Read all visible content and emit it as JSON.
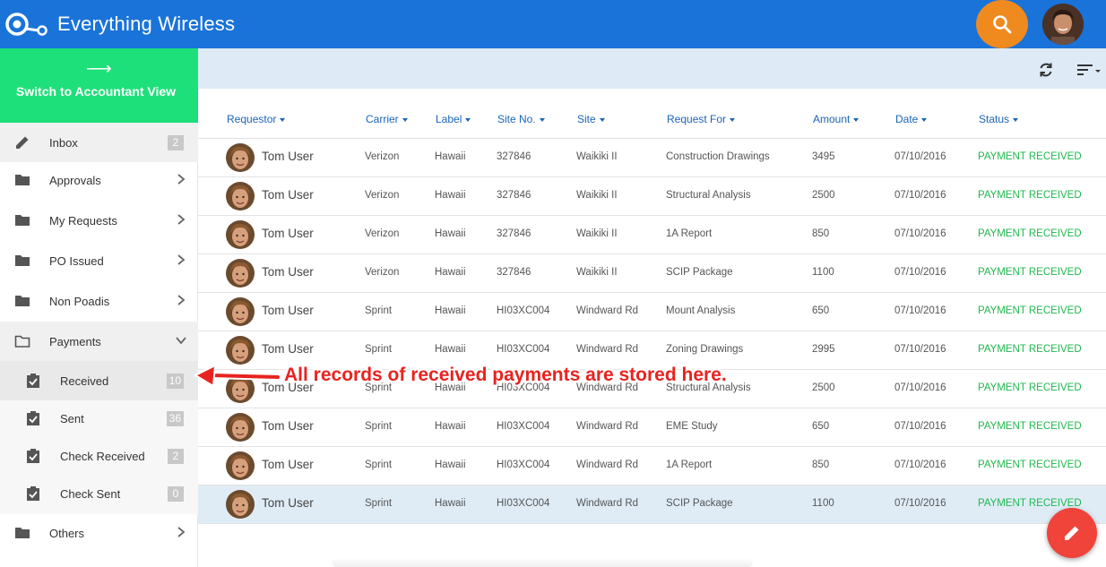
{
  "app": {
    "title": "Everything Wireless"
  },
  "sidebar": {
    "switch_label": "Switch to Accountant View",
    "switch_arrow": "⟶",
    "items": [
      {
        "label": "Inbox",
        "icon": "pencil-icon",
        "badge": "2"
      },
      {
        "label": "Approvals",
        "icon": "folder-icon"
      },
      {
        "label": "My Requests",
        "icon": "folder-icon"
      },
      {
        "label": "PO Issued",
        "icon": "folder-icon"
      },
      {
        "label": "Non Poadis",
        "icon": "folder-icon"
      },
      {
        "label": "Payments",
        "icon": "folder-open-icon",
        "expanded": true
      },
      {
        "label": "Received",
        "icon": "clipboard-check-icon",
        "badge": "10",
        "selected": true
      },
      {
        "label": "Sent",
        "icon": "clipboard-check-icon",
        "badge": "36"
      },
      {
        "label": "Check Received",
        "icon": "clipboard-check-icon",
        "badge": "2"
      },
      {
        "label": "Check Sent",
        "icon": "clipboard-check-icon",
        "badge": "0"
      },
      {
        "label": "Others",
        "icon": "folder-icon"
      }
    ]
  },
  "table": {
    "columns": [
      "Requestor",
      "Carrier",
      "Label",
      "Site No.",
      "Site",
      "Request For",
      "Amount",
      "Date",
      "Status"
    ],
    "rows": [
      {
        "requestor": "Tom User",
        "carrier": "Verizon",
        "label": "Hawaii",
        "site_no": "327846",
        "site": "Waikiki II",
        "request_for": "Construction Drawings",
        "amount": "3495",
        "date": "07/10/2016",
        "status": "PAYMENT RECEIVED"
      },
      {
        "requestor": "Tom User",
        "carrier": "Verizon",
        "label": "Hawaii",
        "site_no": "327846",
        "site": "Waikiki II",
        "request_for": "Structural Analysis",
        "amount": "2500",
        "date": "07/10/2016",
        "status": "PAYMENT RECEIVED"
      },
      {
        "requestor": "Tom User",
        "carrier": "Verizon",
        "label": "Hawaii",
        "site_no": "327846",
        "site": "Waikiki II",
        "request_for": "1A Report",
        "amount": "850",
        "date": "07/10/2016",
        "status": "PAYMENT RECEIVED"
      },
      {
        "requestor": "Tom User",
        "carrier": "Verizon",
        "label": "Hawaii",
        "site_no": "327846",
        "site": "Waikiki II",
        "request_for": "SCIP Package",
        "amount": "1100",
        "date": "07/10/2016",
        "status": "PAYMENT RECEIVED"
      },
      {
        "requestor": "Tom User",
        "carrier": "Sprint",
        "label": "Hawaii",
        "site_no": "HI03XC004",
        "site": "Windward Rd",
        "request_for": "Mount Analysis",
        "amount": "650",
        "date": "07/10/2016",
        "status": "PAYMENT RECEIVED"
      },
      {
        "requestor": "Tom User",
        "carrier": "Sprint",
        "label": "Hawaii",
        "site_no": "HI03XC004",
        "site": "Windward Rd",
        "request_for": "Zoning Drawings",
        "amount": "2995",
        "date": "07/10/2016",
        "status": "PAYMENT RECEIVED"
      },
      {
        "requestor": "Tom User",
        "carrier": "Sprint",
        "label": "Hawaii",
        "site_no": "HI03XC004",
        "site": "Windward Rd",
        "request_for": "Structural Analysis",
        "amount": "2500",
        "date": "07/10/2016",
        "status": "PAYMENT RECEIVED"
      },
      {
        "requestor": "Tom User",
        "carrier": "Sprint",
        "label": "Hawaii",
        "site_no": "HI03XC004",
        "site": "Windward Rd",
        "request_for": "EME Study",
        "amount": "650",
        "date": "07/10/2016",
        "status": "PAYMENT RECEIVED"
      },
      {
        "requestor": "Tom User",
        "carrier": "Sprint",
        "label": "Hawaii",
        "site_no": "HI03XC004",
        "site": "Windward Rd",
        "request_for": "1A Report",
        "amount": "850",
        "date": "07/10/2016",
        "status": "PAYMENT RECEIVED"
      },
      {
        "requestor": "Tom User",
        "carrier": "Sprint",
        "label": "Hawaii",
        "site_no": "HI03XC004",
        "site": "Windward Rd",
        "request_for": "SCIP Package",
        "amount": "1100",
        "date": "07/10/2016",
        "status": "PAYMENT RECEIVED"
      }
    ]
  },
  "annotation": {
    "text": "All records of received payments are stored here."
  },
  "colors": {
    "topbar": "#1a73d9",
    "switch": "#1ee07a",
    "search": "#ef8a1f",
    "status": "#20b84e",
    "fab": "#f0433a",
    "annotation": "#e8231f",
    "header_text": "#1a64b8"
  }
}
